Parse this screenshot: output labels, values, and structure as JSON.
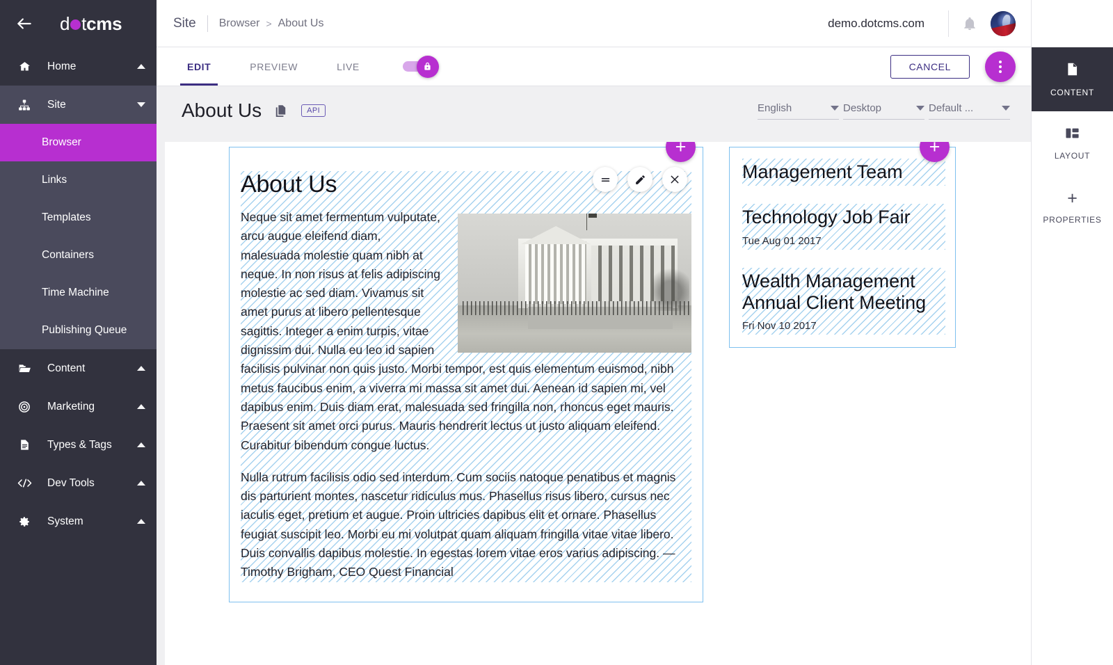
{
  "sidebar": {
    "logo": {
      "part1": "d",
      "dot": "o",
      "part2": "t",
      "part3": "cms"
    },
    "back_icon": "back-arrow-icon",
    "groups": [
      {
        "label": "Home",
        "icon": "home-icon",
        "caret": "up",
        "style": "plain"
      },
      {
        "label": "Site",
        "icon": "sitemap-icon",
        "caret": "down",
        "style": "lighter"
      }
    ],
    "site_children": [
      {
        "label": "Browser",
        "active": true
      },
      {
        "label": "Links",
        "active": false
      },
      {
        "label": "Templates",
        "active": false
      },
      {
        "label": "Containers",
        "active": false
      },
      {
        "label": "Time Machine",
        "active": false
      },
      {
        "label": "Publishing Queue",
        "active": false
      }
    ],
    "lower_groups": [
      {
        "label": "Content",
        "icon": "folder-icon",
        "caret": "up"
      },
      {
        "label": "Marketing",
        "icon": "target-icon",
        "caret": "up"
      },
      {
        "label": "Types & Tags",
        "icon": "document-icon",
        "caret": "up"
      },
      {
        "label": "Dev Tools",
        "icon": "code-icon",
        "caret": "up"
      },
      {
        "label": "System",
        "icon": "gear-icon",
        "caret": "up"
      }
    ]
  },
  "topbar": {
    "breadcrumb": {
      "root": "Site",
      "link": "Browser",
      "separator": ">",
      "current": "About Us"
    },
    "host": "demo.dotcms.com",
    "bell_icon": "bell-icon",
    "avatar": "user-avatar"
  },
  "tabbar": {
    "tabs": [
      {
        "label": "EDIT",
        "active": true
      },
      {
        "label": "PREVIEW",
        "active": false
      },
      {
        "label": "LIVE",
        "active": false
      }
    ],
    "lock_toggle": "lock-icon",
    "cancel_label": "CANCEL",
    "menu_icon": "more-vertical-icon"
  },
  "pagehead": {
    "title": "About Us",
    "copy_icon": "copy-icon",
    "api_badge": "API",
    "selects": [
      {
        "name": "language",
        "value": "English"
      },
      {
        "name": "device",
        "value": "Desktop"
      },
      {
        "name": "persona",
        "value": "Default ..."
      }
    ]
  },
  "editor_tools": {
    "drag_icon": "drag-handle-icon",
    "edit_icon": "pencil-icon",
    "close_icon": "close-icon",
    "add_icon": "+"
  },
  "content": {
    "main_block": {
      "title": "About Us",
      "paragraph1": "Neque sit amet fermentum vulputate, arcu augue eleifend diam, malesuada molestie quam nibh at neque. In non risus at felis adipiscing molestie ac sed diam. Vivamus sit amet purus at libero pellentesque sagittis. Integer a enim turpis, vitae dignissim dui. Nulla eu leo id sapien facilisis pulvinar non quis justo. Morbi tempor, est quis elementum euismod, nibh metus faucibus enim, a viverra mi massa sit amet dui. Aenean id sapien mi, vel dapibus enim. Duis diam erat, malesuada sed fringilla non, rhoncus eget mauris. Praesent sit amet orci purus. Mauris hendrerit lectus ut justo aliquam eleifend. Curabitur bibendum congue luctus.",
      "paragraph2": "Nulla rutrum facilisis odio sed interdum. Cum sociis natoque penatibus et magnis dis parturient montes, nascetur ridiculus mus. Phasellus risus libero, cursus nec iaculis eget, pretium et augue. Proin ultricies dapibus elit et ornare. Phasellus feugiat suscipit leo. Morbi eu mi volutpat quam aliquam fringilla vitae vitae libero. Duis convallis dapibus molestie. In egestas lorem vitae eros varius adipiscing. — Timothy Brigham, CEO Quest Financial",
      "image_alt": "historic-government-building-photo"
    },
    "side_blocks": [
      {
        "title": "Management Team",
        "date": ""
      },
      {
        "title": "Technology Job Fair",
        "date": "Tue Aug 01 2017"
      },
      {
        "title": "Wealth Management Annual Client Meeting",
        "date": "Fri Nov 10 2017"
      }
    ]
  },
  "rail": {
    "items": [
      {
        "label": "CONTENT",
        "icon": "document-icon",
        "active": true
      },
      {
        "label": "LAYOUT",
        "icon": "grid-layout-icon",
        "active": false
      },
      {
        "label": "PROPERTIES",
        "icon": "plus-icon",
        "active": false
      }
    ]
  },
  "colors": {
    "brand_purple": "#b72fd0",
    "sidebar_dark": "#32323e",
    "sidebar_mid": "#4a4a5c",
    "accent_indigo": "#3c2e82",
    "container_border": "#7ec0ef"
  }
}
